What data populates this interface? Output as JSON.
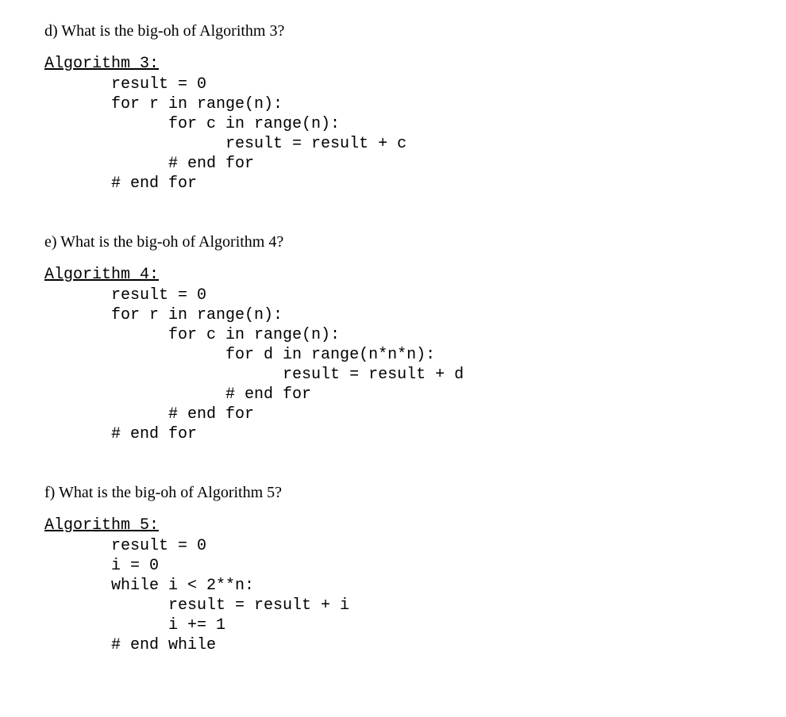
{
  "questions": {
    "d": {
      "prompt": "d)  What is the big-oh of Algorithm 3?",
      "title": "Algorithm 3:",
      "code": "       result = 0\n       for r in range(n):\n             for c in range(n):\n                   result = result + c\n             # end for\n       # end for"
    },
    "e": {
      "prompt": "e)  What is the big-oh of Algorithm 4?",
      "title": "Algorithm 4:",
      "code": "       result = 0\n       for r in range(n):\n             for c in range(n):\n                   for d in range(n*n*n):\n                         result = result + d\n                   # end for\n             # end for\n       # end for"
    },
    "f": {
      "prompt": "f)  What is the big-oh of Algorithm 5?",
      "title": "Algorithm 5:",
      "code": "       result = 0\n       i = 0\n       while i < 2**n:\n             result = result + i\n             i += 1\n       # end while"
    }
  }
}
